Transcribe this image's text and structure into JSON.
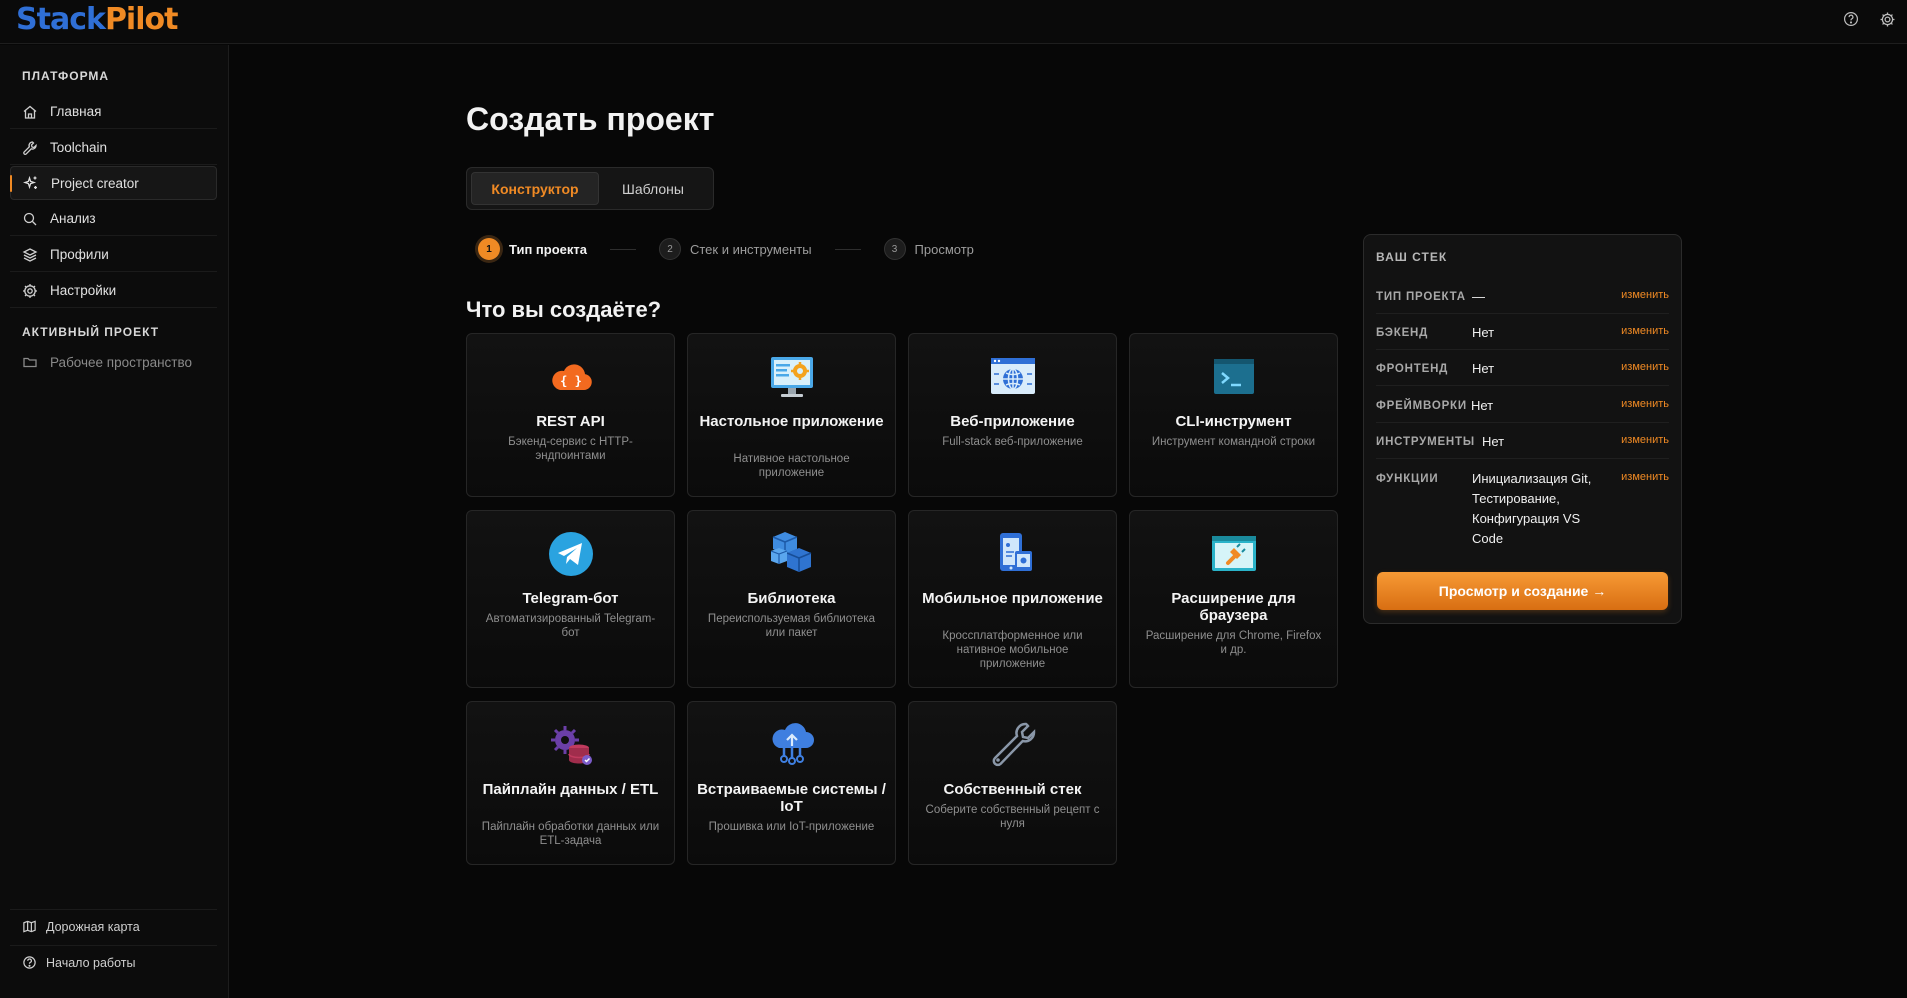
{
  "app": {
    "logo_part1": "Stack",
    "logo_part2": "Pilot"
  },
  "sidebar": {
    "section_platform": "ПЛАТФОРМА",
    "items": [
      {
        "label": "Главная",
        "icon": "home-icon"
      },
      {
        "label": "Toolchain",
        "icon": "wrench-icon"
      },
      {
        "label": "Project creator",
        "icon": "sparkle-icon"
      },
      {
        "label": "Анализ",
        "icon": "search-icon"
      },
      {
        "label": "Профили",
        "icon": "layers-icon"
      },
      {
        "label": "Настройки",
        "icon": "gear-icon"
      }
    ],
    "section_project": "АКТИВНЫЙ ПРОЕКТ",
    "workspace": "Рабочее пространство",
    "bottom": [
      {
        "label": "Дорожная карта",
        "icon": "map-icon"
      },
      {
        "label": "Начало работы",
        "icon": "help-circle-icon"
      }
    ]
  },
  "main": {
    "title": "Создать проект",
    "tabs": [
      "Конструктор",
      "Шаблоны"
    ],
    "steps": [
      {
        "num": "1",
        "label": "Тип проекта"
      },
      {
        "num": "2",
        "label": "Стек и инструменты"
      },
      {
        "num": "3",
        "label": "Просмотр"
      }
    ],
    "question": "Что вы создаёте?",
    "cards": [
      {
        "title": "REST API",
        "desc": "Бэкенд-сервис с HTTP-эндпоинтами",
        "icon": "cloud-api-icon"
      },
      {
        "title": "Настольное приложение",
        "desc": "Нативное настольное приложение",
        "icon": "desktop-gear-icon"
      },
      {
        "title": "Веб-приложение",
        "desc": "Full-stack веб-приложение",
        "icon": "web-globe-icon"
      },
      {
        "title": "CLI-инструмент",
        "desc": "Инструмент командной строки",
        "icon": "terminal-icon"
      },
      {
        "title": "Telegram-бот",
        "desc": "Автоматизированный Telegram-бот",
        "icon": "telegram-icon"
      },
      {
        "title": "Библиотека",
        "desc": "Переиспользуемая библиотека или пакет",
        "icon": "cubes-icon"
      },
      {
        "title": "Мобильное приложение",
        "desc": "Кроссплатформенное или нативное мобильное приложение",
        "icon": "mobile-icon"
      },
      {
        "title": "Расширение для браузера",
        "desc": "Расширение для Chrome, Firefox и др.",
        "icon": "plugin-icon"
      },
      {
        "title": "Пайплайн данных / ETL",
        "desc": "Пайплайн обработки данных или ETL-задача",
        "icon": "data-gear-icon"
      },
      {
        "title": "Встраиваемые системы / IoT",
        "desc": "Прошивка или IoT-приложение",
        "icon": "iot-cloud-icon"
      },
      {
        "title": "Собственный стек",
        "desc": "Соберите собственный рецепт с нуля",
        "icon": "tool-icon"
      }
    ]
  },
  "stack": {
    "heading": "ВАШ СТЕК",
    "edit_label": "изменить",
    "rows": [
      {
        "key": "ТИП ПРОЕКТА",
        "value": "—"
      },
      {
        "key": "БЭКЕНД",
        "value": "Нет"
      },
      {
        "key": "ФРОНТЕНД",
        "value": "Нет"
      },
      {
        "key": "ФРЕЙМВОРКИ",
        "value": "Нет"
      },
      {
        "key": "ИНСТРУМЕНТЫ",
        "value": "Нет"
      },
      {
        "key": "ФУНКЦИИ",
        "value": "Инициализация Git, Тестирование, Конфигурация VS Code"
      }
    ],
    "cta": "Просмотр и создание →"
  },
  "colors": {
    "accent": "#f08a24",
    "logo_blue": "#2f6fd6",
    "background": "#070707"
  }
}
